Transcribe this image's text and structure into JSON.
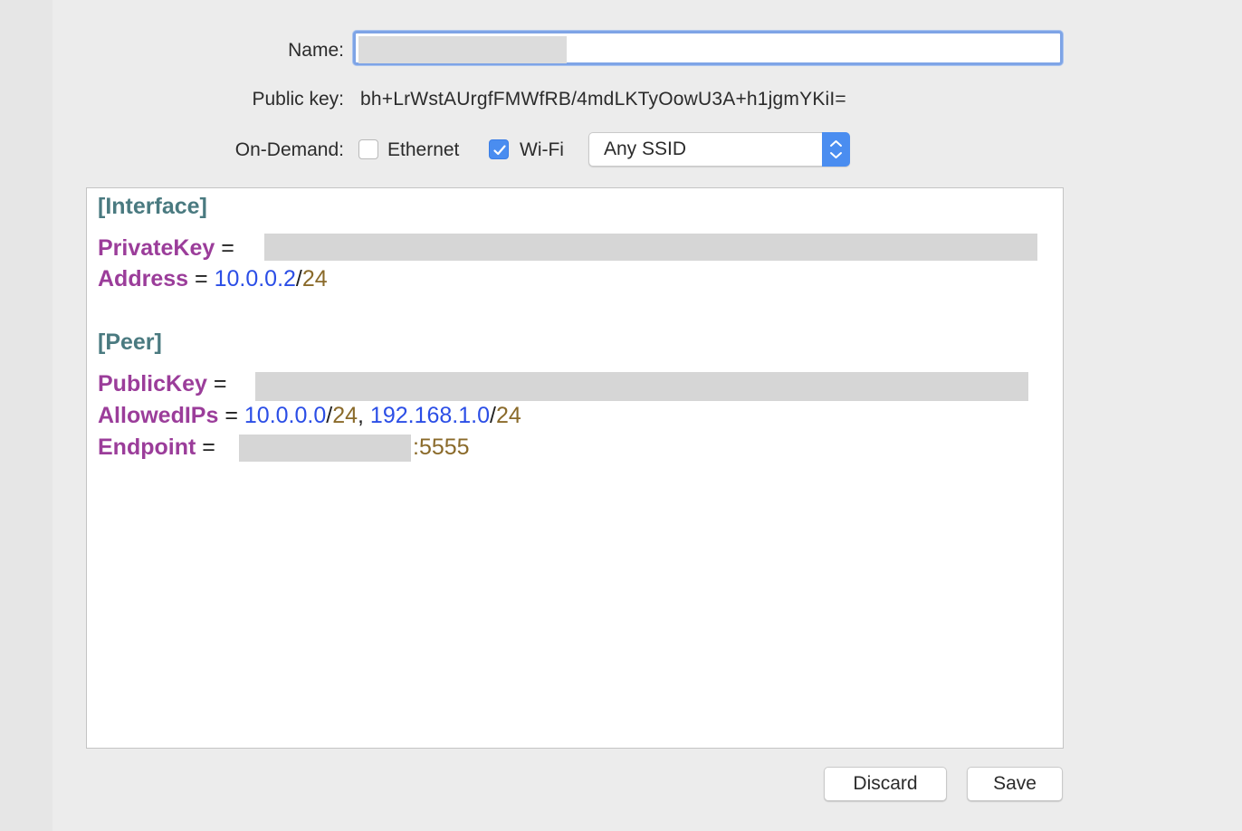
{
  "form": {
    "name_label": "Name:",
    "name_value": "",
    "public_key_label": "Public key:",
    "public_key_value": "bh+LrWstAUrgfFMWfRB/4mdLKTyOowU3A+h1jgmYKiI=",
    "on_demand_label": "On-Demand:",
    "ethernet_label": "Ethernet",
    "ethernet_checked": false,
    "wifi_label": "Wi-Fi",
    "wifi_checked": true,
    "ssid_selected": "Any SSID"
  },
  "config": {
    "interface_header": "[Interface]",
    "private_key_key": "PrivateKey",
    "address_key": "Address",
    "address_ip": "10.0.0.2",
    "address_cidr": "24",
    "peer_header": "[Peer]",
    "public_key_key": "PublicKey",
    "allowed_ips_key": "AllowedIPs",
    "allowed_ip_1": "10.0.0.0",
    "allowed_cidr_1": "24",
    "allowed_ip_2": "192.168.1.0",
    "allowed_cidr_2": "24",
    "endpoint_key": "Endpoint",
    "endpoint_port": ":5555",
    "equals": "=",
    "slash": "/",
    "comma": ","
  },
  "buttons": {
    "discard_label": "Discard",
    "save_label": "Save"
  },
  "colors": {
    "accent": "#4a8df0",
    "section": "#4a7a80",
    "key": "#9b3d9a",
    "ip": "#2b4ee6",
    "cidr": "#8a6a2a"
  }
}
